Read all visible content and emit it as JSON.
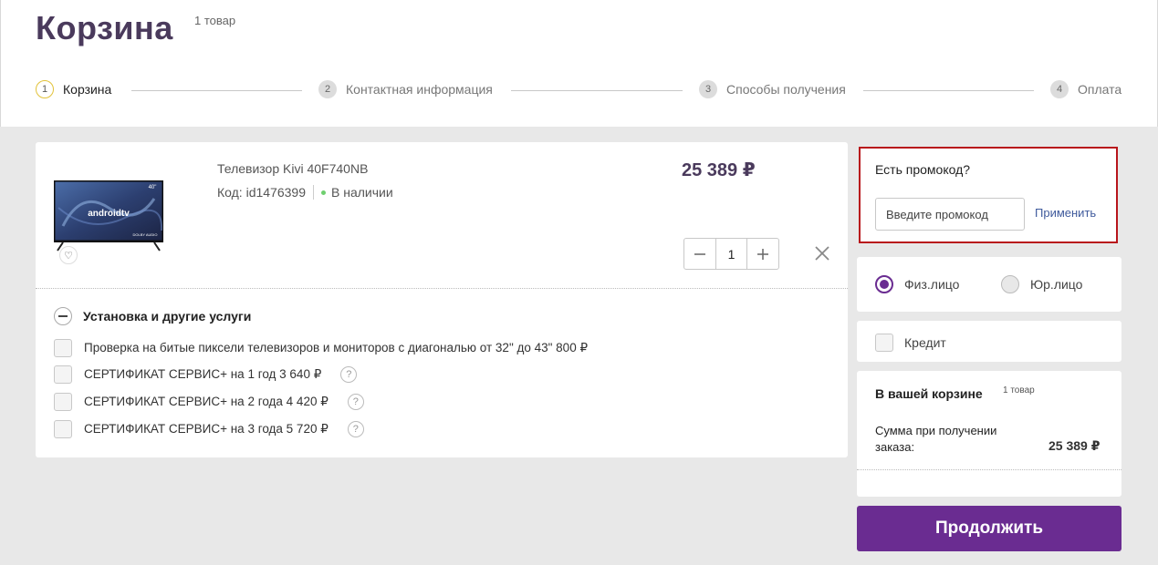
{
  "header": {
    "title": "Корзина",
    "count": "1 товар"
  },
  "steps": [
    {
      "num": "1",
      "label": "Корзина"
    },
    {
      "num": "2",
      "label": "Контактная информация"
    },
    {
      "num": "3",
      "label": "Способы получения"
    },
    {
      "num": "4",
      "label": "Оплата"
    }
  ],
  "product": {
    "name": "Телевизор Kivi 40F740NB",
    "code": "Код: id1476399",
    "availability": "В наличии",
    "price": "25 389 ₽",
    "quantity": "1",
    "image_text": {
      "brand": "androidtv",
      "size": "40\"",
      "badge": "DOLBY AUDIO"
    }
  },
  "services": {
    "title": "Установка и другие услуги",
    "items": [
      {
        "label": "Проверка на битые пиксели телевизоров и мониторов с диагональю от 32\" до 43\" 800 ₽",
        "help": ""
      },
      {
        "label": "СЕРТИФИКАТ СЕРВИС+ на 1 год 3 640 ₽",
        "help": "?"
      },
      {
        "label": "СЕРТИФИКАТ СЕРВИС+ на 2 года 4 420 ₽",
        "help": "?"
      },
      {
        "label": "СЕРТИФИКАТ СЕРВИС+ на 3 года 5 720 ₽",
        "help": "?"
      }
    ]
  },
  "promo": {
    "title": "Есть промокод?",
    "placeholder": "Введите промокод",
    "apply": "Применить"
  },
  "customer_type": {
    "individual": "Физ.лицо",
    "legal": "Юр.лицо",
    "selected": "individual"
  },
  "credit": {
    "label": "Кредит"
  },
  "summary": {
    "title": "В вашей корзине",
    "count": "1 товар",
    "label": "Сумма при получении заказа:",
    "total": "25 389 ₽"
  },
  "actions": {
    "continue": "Продолжить"
  },
  "colors": {
    "brand_purple": "#6a2c91",
    "title_color": "#4a3a5c",
    "highlight_red": "#b8151b",
    "step_active_ring": "#e2c23a",
    "in_stock_green": "#6fcf6f"
  }
}
